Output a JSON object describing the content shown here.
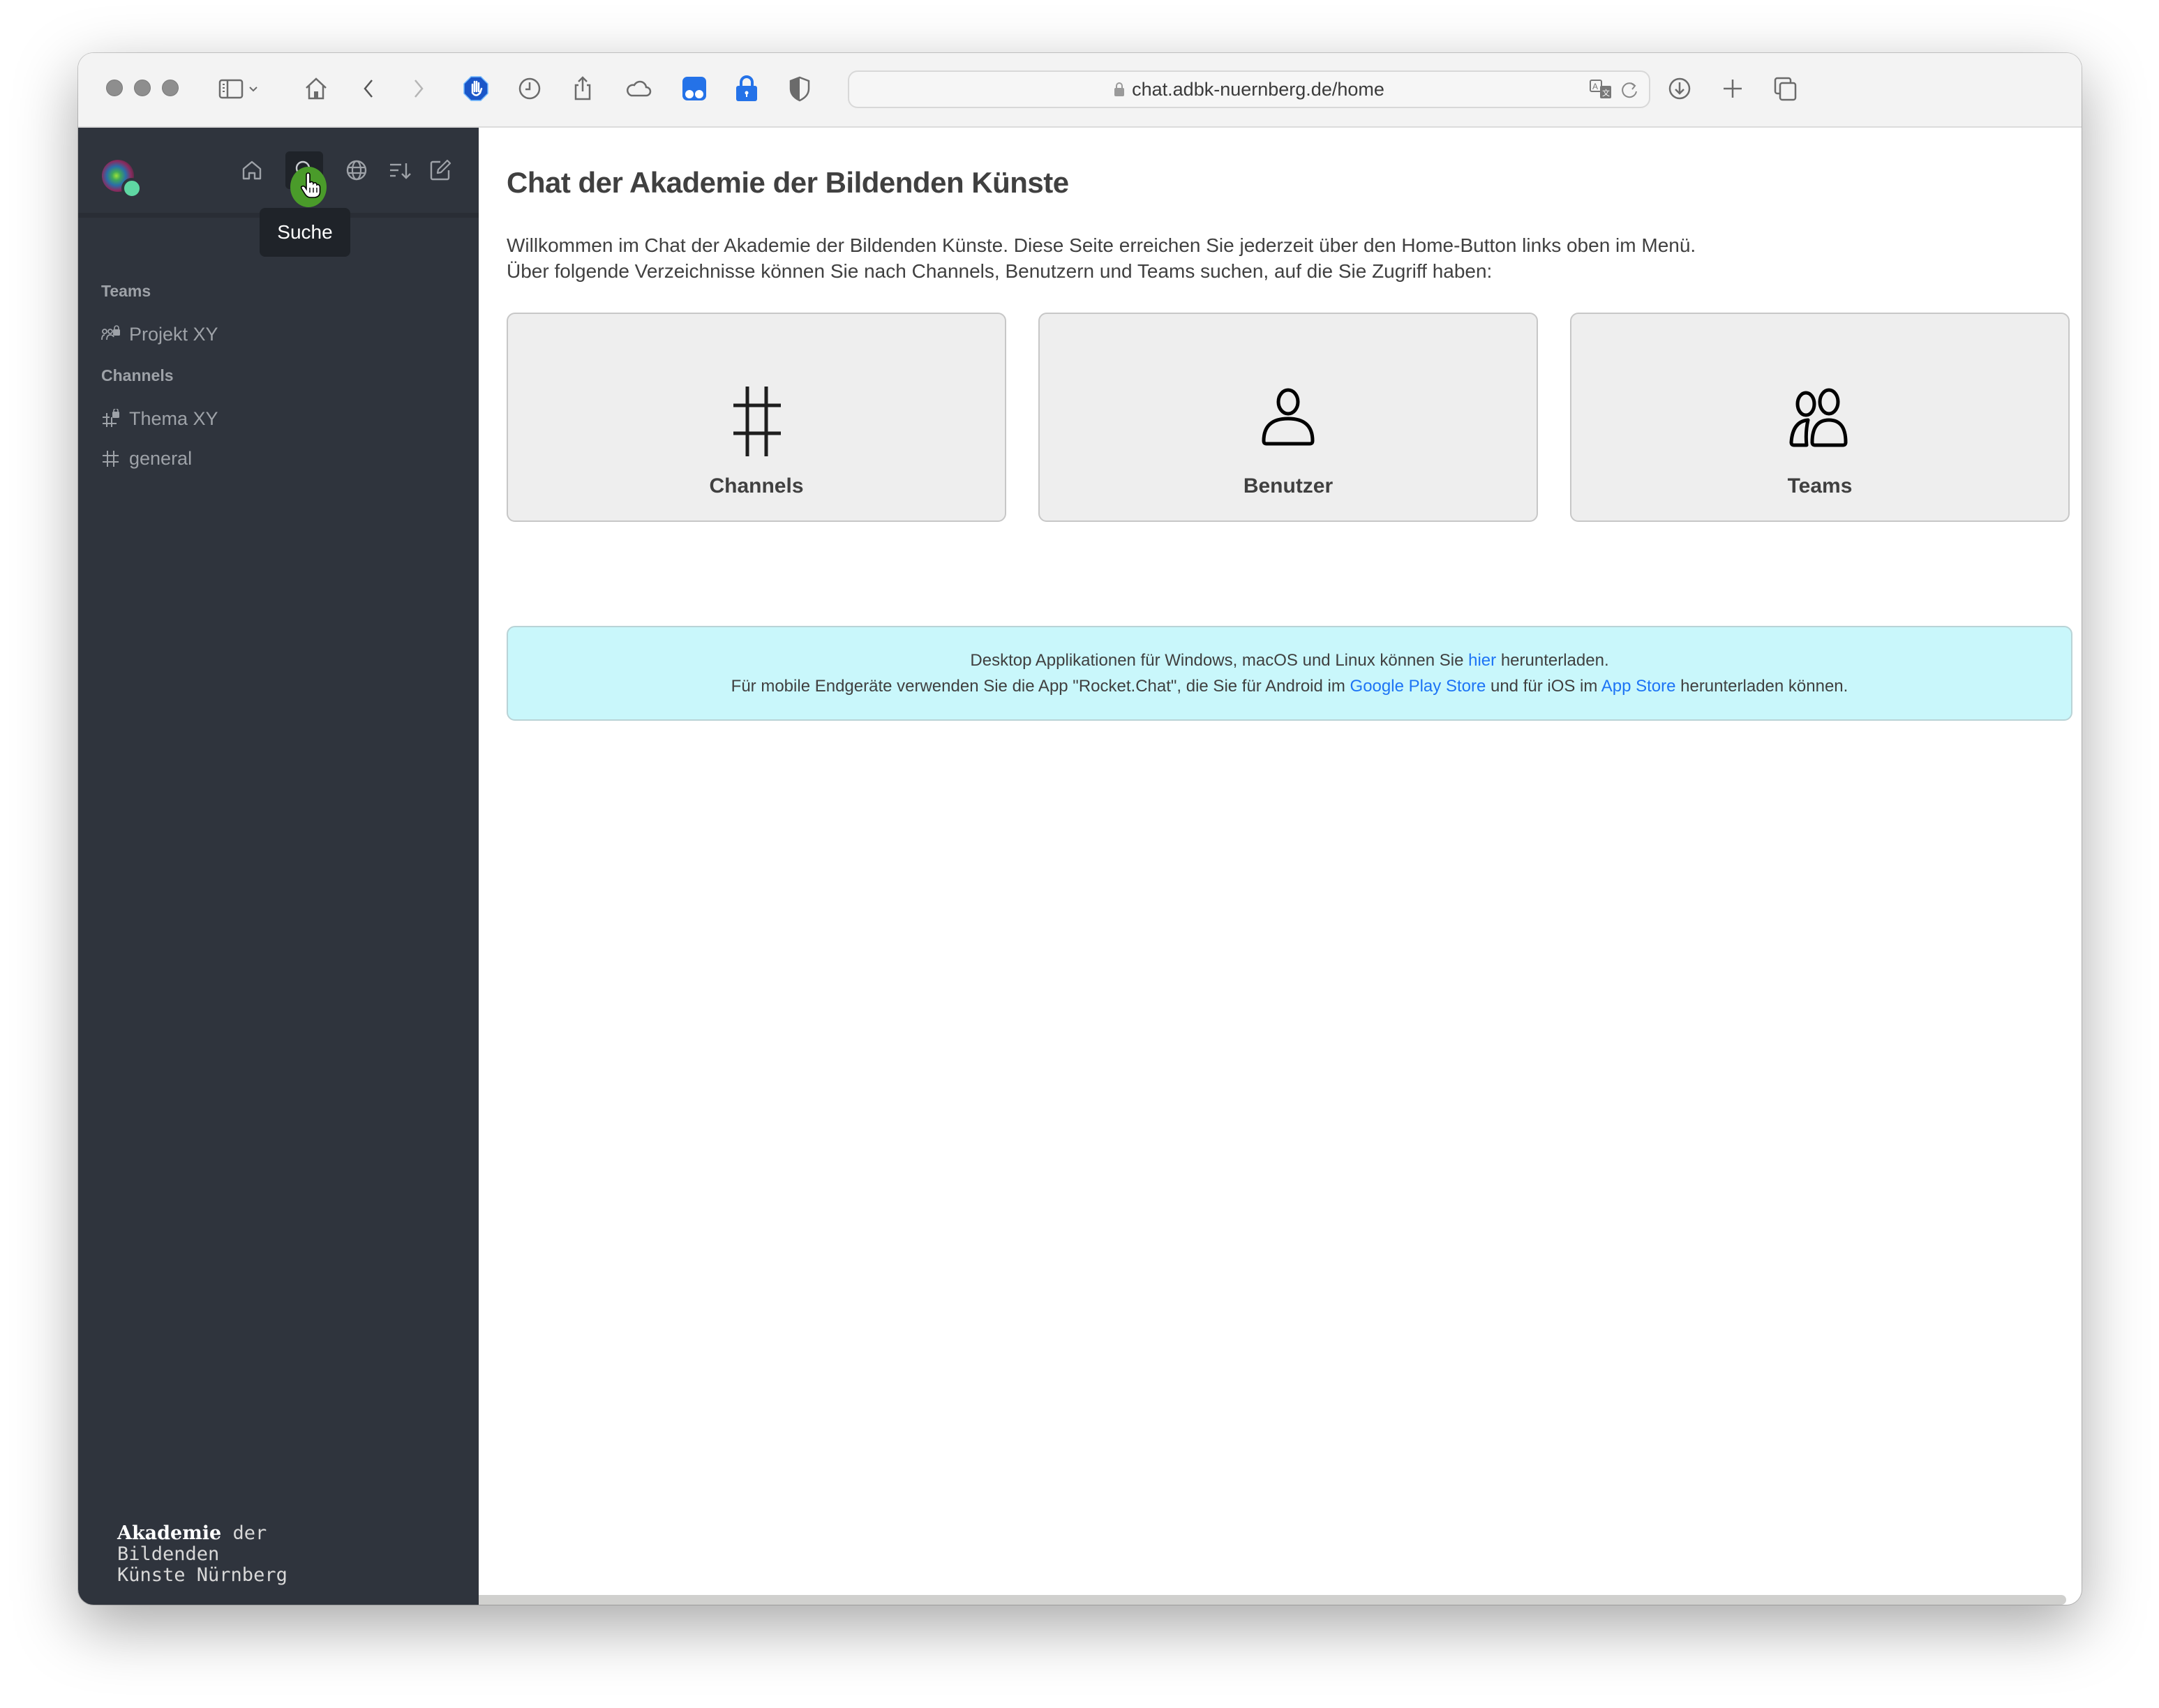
{
  "browser": {
    "url": "chat.adbk-nuernberg.de/home",
    "toolbar_icons": [
      "sidebar-toggle-icon",
      "chevron-down-icon",
      "home-icon",
      "back-icon",
      "forward-icon",
      "adblock-hand-icon",
      "history-clock-icon",
      "share-icon",
      "cloud-icon",
      "extension-dots-icon",
      "password-lock-icon",
      "shield-icon",
      "download-icon",
      "new-tab-plus-icon",
      "tabs-overview-icon"
    ]
  },
  "sidebar": {
    "header_buttons": [
      {
        "name": "home",
        "icon": "home-icon"
      },
      {
        "name": "search",
        "icon": "search-icon"
      },
      {
        "name": "directory",
        "icon": "globe-icon"
      },
      {
        "name": "sort",
        "icon": "sort-icon"
      },
      {
        "name": "create-new",
        "icon": "edit-icon"
      }
    ],
    "tooltip": "Suche",
    "sections": [
      {
        "title": "Teams",
        "items": [
          {
            "label": "Projekt XY",
            "icon": "team-lock-icon"
          }
        ]
      },
      {
        "title": "Channels",
        "items": [
          {
            "label": "Thema XY",
            "icon": "hash-lock-icon"
          },
          {
            "label": "general",
            "icon": "hash-icon"
          }
        ]
      }
    ],
    "brand": {
      "line1_strong": "Akademie",
      "line1_rest": " der",
      "line2": "Bildenden",
      "line3": "Künste Nürnberg"
    }
  },
  "main": {
    "title": "Chat der Akademie der Bildenden Künste",
    "intro_line1": "Willkommen im Chat der Akademie der Bildenden Künste. Diese Seite erreichen Sie jederzeit über den Home-Button links oben im Menü.",
    "intro_line2": "Über folgende Verzeichnisse können Sie nach Channels, Benutzern und Teams suchen, auf die Sie Zugriff haben:",
    "cards": [
      {
        "label": "Channels",
        "icon": "hash-icon"
      },
      {
        "label": "Benutzer",
        "icon": "user-icon"
      },
      {
        "label": "Teams",
        "icon": "team-icon"
      }
    ],
    "info": {
      "line1_pre": "Desktop Applikationen für Windows, macOS und Linux können Sie ",
      "line1_link": "hier",
      "line1_post": " herunterladen.",
      "line2_pre": "Für mobile Endgeräte verwenden Sie die App \"Rocket.Chat\", die Sie für Android im ",
      "line2_link1": "Google Play Store",
      "line2_mid": " und für iOS im ",
      "line2_link2": "App Store",
      "line2_post": " herunterladen können."
    }
  },
  "colors": {
    "sidebar_bg": "#2f343d",
    "link": "#1d74f5",
    "info_bg": "#c9f7fb",
    "status_online": "#5fd7a3"
  }
}
